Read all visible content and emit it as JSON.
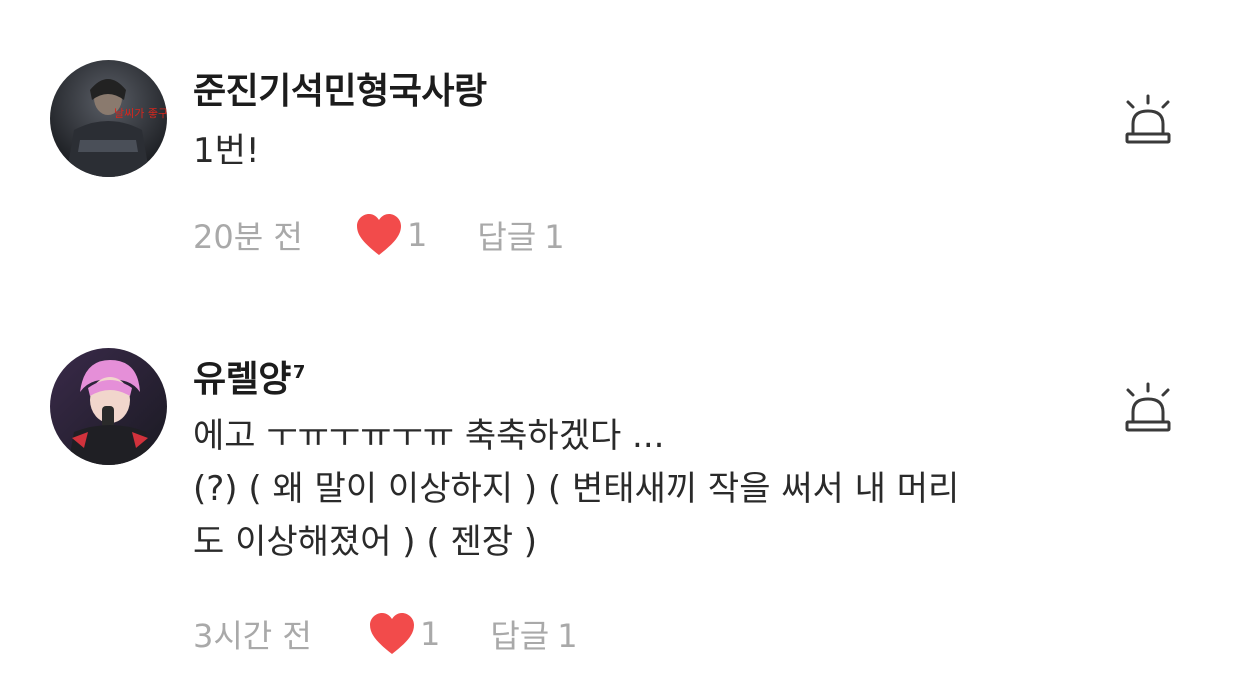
{
  "comments": [
    {
      "username": "준진기석민형국사랑",
      "badge": "",
      "avatar": "avatar-dark-figure",
      "avatar_caption": "날씨가 좋구나",
      "body": "1번!",
      "time": "20분 전",
      "likes": "1",
      "reply_label": "답글",
      "reply_count": "1",
      "report_icon": "siren-icon"
    },
    {
      "username": "유렐양",
      "badge": "7",
      "avatar": "avatar-pink-hair",
      "body": "에고 ㅜㅠㅜㅠㅜㅠ 축축하겠다 ...\n(?) ( 왜 말이 이상하지 ) ( 변태새끼 작을 써서 내 머리\n도 이상해졌어 ) ( 젠장 )",
      "time": "3시간 전",
      "likes": "1",
      "reply_label": "답글",
      "reply_count": "1",
      "report_icon": "siren-icon"
    }
  ],
  "colors": {
    "heart": "#f24b4b",
    "meta_text": "#a9a9a9",
    "username": "#1c1c1c",
    "icon_stroke": "#3a3a3a"
  }
}
